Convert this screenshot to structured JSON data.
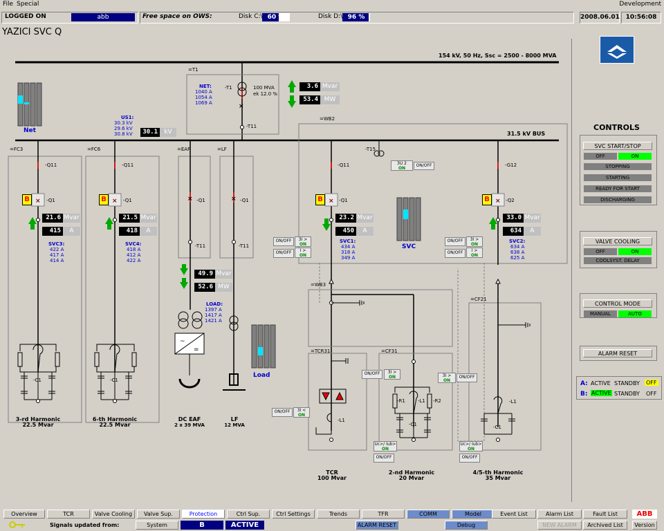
{
  "menu": {
    "file": "File",
    "special": "Special",
    "right": "Development"
  },
  "status": {
    "logged_on_label": "LOGGED ON",
    "user": "abb",
    "free_space_label": "Free space on OWS:",
    "disk_c_label": "Disk C:\\",
    "disk_c_pct": 60,
    "disk_c_text": "60 %",
    "disk_d_label": "Disk D:\\",
    "disk_d_pct": 96,
    "disk_d_text": "96 %",
    "date": "2008.06.01",
    "time": "10:56:08"
  },
  "station_title": "YAZICI SVC Q",
  "bus154_label": "154 kV, 50 Hz, Ssc = 2500 - 8000 MVA",
  "bus31_label": "31.5 kV BUS",
  "net_label": "Net",
  "t1": {
    "box_label": "=T1",
    "name": "-T1",
    "rating1": "100 MVA",
    "rating2": "ek 12.0 %",
    "net_title": "NET:",
    "currents": [
      "1040 A",
      "1054 A",
      "1069 A"
    ],
    "t11": "-T11",
    "mvar": "3.6",
    "mvar_unit": "Mvar",
    "mw": "53.4",
    "mw_unit": "MW"
  },
  "us1": {
    "title": "US1:",
    "v1": "30.3 kV",
    "v2": "29.6 kV",
    "v3": "30.8 kV",
    "value": "30.1",
    "unit": "kV"
  },
  "fc3": {
    "box": "=FC3",
    "q11": "-Q11",
    "q1": "-Q1",
    "b": "B",
    "mvar": "21.6",
    "mvar_unit": "Mvar",
    "amp": "415",
    "amp_unit": "A",
    "svc_title": "SVC3:",
    "currents": [
      "422 A",
      "417 A",
      "414 A"
    ],
    "c1": "-C1",
    "caption1": "3-rd Harmonic",
    "caption2": "22.5 Mvar"
  },
  "fc6": {
    "box": "=FC6",
    "q11": "-Q11",
    "q1": "-Q1",
    "b": "B",
    "mvar": "21.5",
    "mvar_unit": "Mvar",
    "amp": "418",
    "amp_unit": "A",
    "svc_title": "SVC4:",
    "currents": [
      "418 A",
      "412 A",
      "422 A"
    ],
    "c1": "-C1",
    "caption1": "6-th Harmonic",
    "caption2": "22.5 Mvar"
  },
  "eaf": {
    "box": "=EAF",
    "q1": "-Q1",
    "t11": "-T11",
    "mvar": "49.9",
    "mvar_unit": "Mvar",
    "mw": "52.6",
    "mw_unit": "MW",
    "load_title": "LOAD:",
    "currents": [
      "1397 A",
      "1417 A",
      "1421 A"
    ],
    "caption1": "DC EAF",
    "caption2": "2 x 39 MVA"
  },
  "lf": {
    "box": "=LF",
    "q1": "-Q1",
    "t11": "-T11",
    "caption1": "LF",
    "caption2": "12 MVA",
    "load_label": "Load"
  },
  "wb2": {
    "box": "=WB2",
    "t15": "-T15",
    "u2": "3U 2",
    "on": "ON",
    "onoff": "ON/OFF"
  },
  "svc1": {
    "q11": "-Q11",
    "q1": "-Q1",
    "b": "B",
    "mvar": "23.2",
    "mvar_unit": "Mvar",
    "amp": "450",
    "amp_unit": "A",
    "title": "SVC1:",
    "currents": [
      "434 A",
      "318 A",
      "349 A"
    ],
    "onoff": "ON/OFF",
    "i3": "3I >",
    "i1": "I >",
    "on": "ON"
  },
  "svc_label": "SVC",
  "svc2": {
    "q12": "-G12",
    "q2": "-Q2",
    "b": "B",
    "mvar": "33.0",
    "mvar_unit": "Mvar",
    "amp": "634",
    "amp_unit": "A",
    "title": "SVC2:",
    "currents": [
      "634 A",
      "638 A",
      "625 A"
    ],
    "onoff": "ON/OFF",
    "i3": "3I >",
    "i1": "I >",
    "on": "ON"
  },
  "wb3": {
    "box": "=WB3"
  },
  "tcr": {
    "box": "=TCR31",
    "l1": "-L1",
    "onoff": "ON/OFF",
    "i3": "3I <",
    "on": "ON",
    "caption1": "TCR",
    "caption2": "100 Mvar"
  },
  "cf31": {
    "box": "=CF31",
    "r1": "-R1",
    "l1": "-L1",
    "r2": "-R2",
    "c1": "-C1",
    "onoff": "ON/OFF",
    "i3": "3I >",
    "on": "ON",
    "ue": "Uc>/ Iub>",
    "caption1": "2-nd Harmonic",
    "caption2": "20 Mvar"
  },
  "cf21": {
    "box": "=CF21",
    "l1": "-L1",
    "c1": "-C1",
    "ue": "Uc>/ Iub>",
    "on": "ON",
    "onoff": "ON/OFF",
    "caption1": "4/5-th Harmonic",
    "caption2": "35 Mvar"
  },
  "controls": {
    "title": "CONTROLS",
    "svc_start_stop": "SVC  START/STOP",
    "off": "OFF",
    "on": "ON",
    "stopping": "STOPPING",
    "starting": "STARTING",
    "ready": "READY FOR START",
    "discharging": "DISCHARGING",
    "valve_cooling": "VALVE COOLING",
    "coolsyst": "COOLSYST. DELAY",
    "control_mode": "CONTROL MODE",
    "manual": "MANUAL",
    "auto": "AUTO",
    "alarm_reset": "ALARM RESET",
    "a_label": "A:",
    "b_label": "B:",
    "active": "ACTIVE",
    "standby": "STANDBY",
    "off_a": "OFF",
    "off_b": "OFF"
  },
  "nav": {
    "row1": [
      "Overview",
      "TCR",
      "Valve Cooling",
      "Valve Sup.",
      "Protection",
      "Ctrl Sup.",
      "Ctrl Settings",
      "Trends",
      "TFR",
      "COMM",
      "Model"
    ],
    "right1": [
      "Event List",
      "Alarm List",
      "Fault List"
    ],
    "signals_label": "Signals updated from:",
    "system": "System",
    "system_val": "B",
    "active": "ACTIVE",
    "alarm_reset": "ALARM RESET",
    "debug": "Debug",
    "new_alarm": "NEW ALARM",
    "archived": "Archived List",
    "version": "Version",
    "abb": "ABB"
  },
  "colors": {
    "navy": "#000080",
    "green": "#00ff00",
    "blue_text": "#0000cc",
    "bus": "#000000"
  }
}
